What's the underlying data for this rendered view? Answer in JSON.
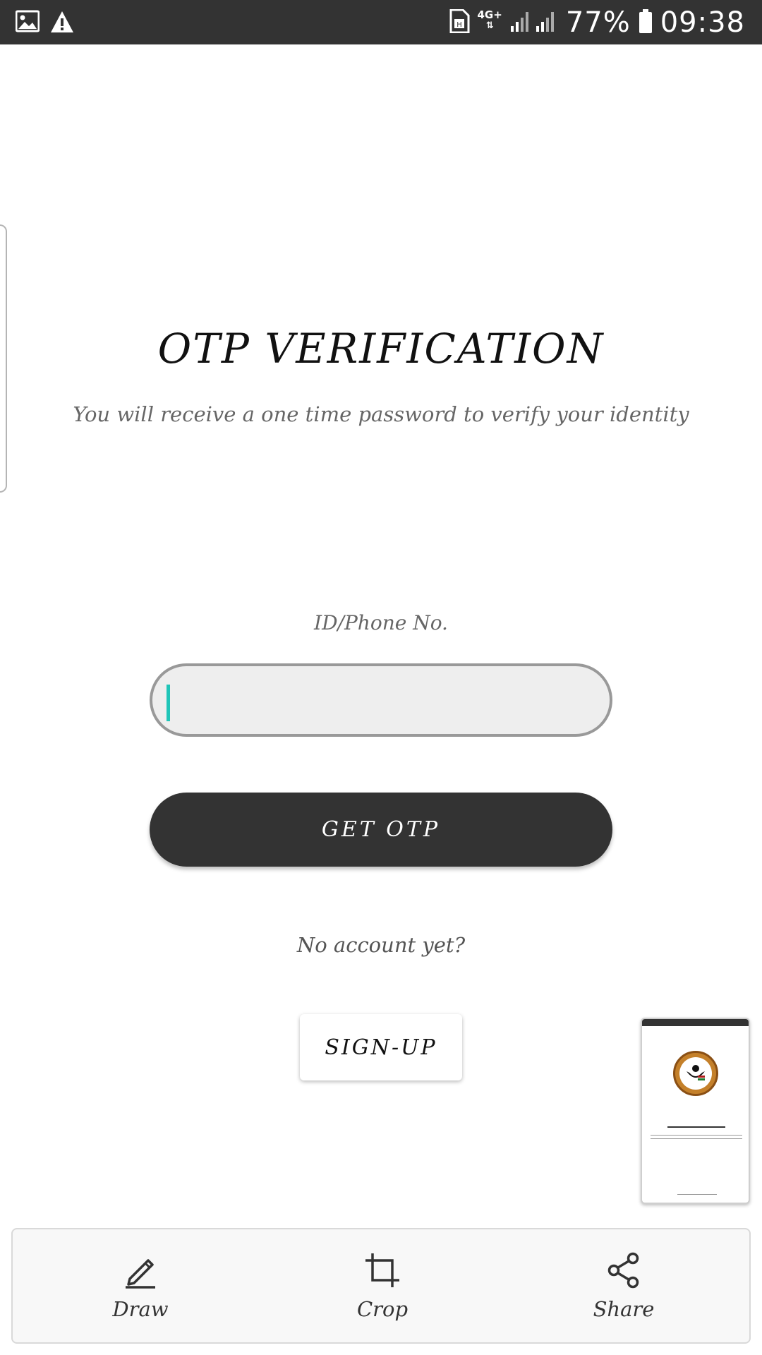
{
  "status_bar": {
    "signal_label": "4G+",
    "battery_percent": "77%",
    "time": "09:38"
  },
  "main": {
    "title": "OTP VERIFICATION",
    "subtitle": "You will receive a one time password to verify your identity",
    "field_label": "ID/Phone No.",
    "input_value": "",
    "get_otp_label": "GET OTP",
    "no_account_text": "No account yet?",
    "signup_label": "SIGN-UP"
  },
  "action_bar": {
    "draw_label": "Draw",
    "crop_label": "Crop",
    "share_label": "Share"
  },
  "colors": {
    "status_bar_bg": "#333333",
    "button_dark": "#333333",
    "caret": "#20c5b8",
    "input_bg": "#eeeeee"
  },
  "icons": [
    "image-icon",
    "warning-icon",
    "sim-icon",
    "signal-icon",
    "battery-icon",
    "pencil-icon",
    "crop-icon",
    "share-icon"
  ]
}
